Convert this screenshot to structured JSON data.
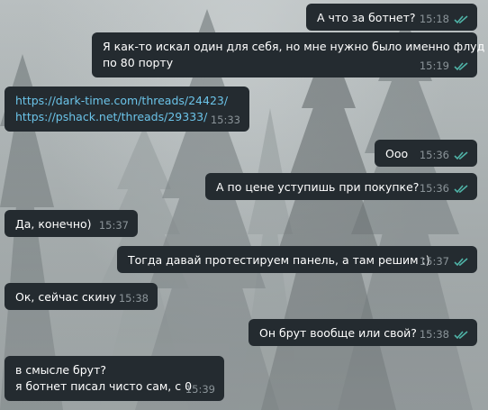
{
  "messages": [
    {
      "dir": "out",
      "lines": [
        "А что за ботнет?"
      ],
      "time": "15:18"
    },
    {
      "dir": "out",
      "lines": [
        "Я как-то искал один для себя, но мне нужно было именно флуд",
        "по 80 порту"
      ],
      "time": "15:19"
    },
    {
      "dir": "in",
      "lines": [
        "https://dark-time.com/threads/24423/",
        "https://pshack.net/threads/29333/"
      ],
      "time": "15:33"
    },
    {
      "dir": "out",
      "lines": [
        "Ооо"
      ],
      "time": "15:36"
    },
    {
      "dir": "out",
      "lines": [
        "А по цене уступишь при покупке?"
      ],
      "time": "15:36"
    },
    {
      "dir": "in",
      "lines": [
        "Да, конечно)"
      ],
      "time": "15:37"
    },
    {
      "dir": "out",
      "lines": [
        "Тогда давай протестируем панель, а там решим :)"
      ],
      "time": "15:37"
    },
    {
      "dir": "in",
      "lines": [
        "Ок, сейчас скину"
      ],
      "time": "15:38"
    },
    {
      "dir": "out",
      "lines": [
        "Он брут вообще или свой?"
      ],
      "time": "15:38"
    },
    {
      "dir": "in",
      "lines": [
        "в смысле брут?",
        "я ботнет писал чисто сам, с 0"
      ],
      "time": "15:39"
    }
  ],
  "colors": {
    "bubble": "#242b30",
    "time": "#8b9499",
    "read_check": "#4fb3a7",
    "link": "#6bc3e8"
  },
  "icons": {
    "read_status": "double-check-icon"
  }
}
